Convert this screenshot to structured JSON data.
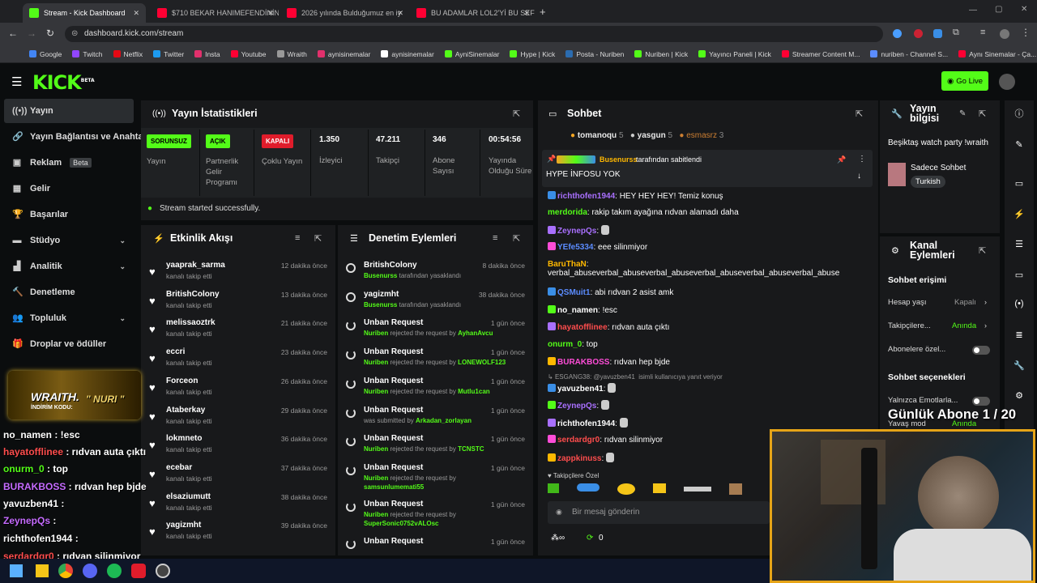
{
  "browser": {
    "tabs": [
      {
        "title": "Stream - Kick Dashboard"
      },
      {
        "title": "$710 BEKAR HANIMEFENDİNİN"
      },
      {
        "title": "2026 yılında Bulduğumuz en iy"
      },
      {
        "title": "BU ADAMLAR LOL2'Yİ BU SEFER"
      }
    ],
    "url": "dashboard.kick.com/stream",
    "bookmarks": [
      "Google",
      "Twitch",
      "Netflix",
      "Twitter",
      "Insta",
      "Youtube",
      "Wraith",
      "aynisinemalar",
      "aynisinemalar",
      "AyniSinemalar",
      "Hype | Kick",
      "Posta - Nuriben",
      "Nuriben | Kick",
      "Yayıncı Paneli | Kick",
      "Streamer Content M...",
      "nuriben - Channel S...",
      "Aynı Sinemalar - Ça..."
    ]
  },
  "header": {
    "logo": "KICK",
    "logo_beta": "BETA",
    "go_live": "Go Live"
  },
  "sidebar": {
    "items": [
      {
        "label": "Yayın"
      },
      {
        "label": "Yayın Bağlantısı ve Anahtar"
      },
      {
        "label": "Reklam",
        "badge": "Beta"
      },
      {
        "label": "Gelir"
      },
      {
        "label": "Başarılar"
      },
      {
        "label": "Stüdyo"
      },
      {
        "label": "Analitik"
      },
      {
        "label": "Denetleme"
      },
      {
        "label": "Topluluk"
      },
      {
        "label": "Droplar ve ödüller"
      }
    ]
  },
  "stats": {
    "title": "Yayın İstatistikleri",
    "items": [
      {
        "badge": "SORUNSUZ",
        "label": "Yayın"
      },
      {
        "badge": "AÇIK",
        "label": "Partnerlik Gelir Programı"
      },
      {
        "badge": "KAPALI",
        "label": "Çoklu Yayın"
      },
      {
        "value": "1.350",
        "label": "İzleyici"
      },
      {
        "value": "47.211",
        "label": "Takipçi"
      },
      {
        "value": "346",
        "label": "Abone Sayısı"
      },
      {
        "value": "00:54:56",
        "label": "Yayında Olduğu Süre"
      }
    ],
    "success": "Stream started successfully."
  },
  "activity": {
    "title": "Etkinlik Akışı",
    "items": [
      {
        "name": "yaaprak_sarma",
        "sub": "kanalı takip etti",
        "time": "12 dakika önce"
      },
      {
        "name": "BritishColony",
        "sub": "kanalı takip etti",
        "time": "13 dakika önce"
      },
      {
        "name": "melissaoztrk",
        "sub": "kanalı takip etti",
        "time": "21 dakika önce"
      },
      {
        "name": "eccri",
        "sub": "kanalı takip etti",
        "time": "23 dakika önce"
      },
      {
        "name": "Forceon",
        "sub": "kanalı takip etti",
        "time": "26 dakika önce"
      },
      {
        "name": "Ataberkay",
        "sub": "kanalı takip etti",
        "time": "29 dakika önce"
      },
      {
        "name": "lokmneto",
        "sub": "kanalı takip etti",
        "time": "36 dakika önce"
      },
      {
        "name": "ecebar",
        "sub": "kanalı takip etti",
        "time": "37 dakika önce"
      },
      {
        "name": "elsaziumutt",
        "sub": "kanalı takip etti",
        "time": "38 dakika önce"
      },
      {
        "name": "yagizmht",
        "sub": "kanalı takip etti",
        "time": "39 dakika önce"
      }
    ]
  },
  "moderation": {
    "title": "Denetim Eylemleri",
    "items": [
      {
        "name": "BritishColony",
        "actor": "Busenurss",
        "rest": "tarafından yasaklandı",
        "target": "",
        "time": "8 dakika önce"
      },
      {
        "name": "yagizmht",
        "actor": "Busenurss",
        "rest": "tarafından yasaklandı",
        "target": "",
        "time": "38 dakika önce"
      },
      {
        "name": "Unban Request",
        "actor": "Nuriben",
        "rest": "rejected the request by",
        "target": "AyhanAvcu",
        "time": "1 gün önce"
      },
      {
        "name": "Unban Request",
        "actor": "Nuriben",
        "rest": "rejected the request by",
        "target": "LONEWOLF123",
        "time": "1 gün önce"
      },
      {
        "name": "Unban Request",
        "actor": "Nuriben",
        "rest": "rejected the request by",
        "target": "Mutlu1can",
        "time": "1 gün önce"
      },
      {
        "name": "Unban Request",
        "actor": "",
        "rest": "was submitted by",
        "target": "Arkadan_zorlayan",
        "time": "1 gün önce"
      },
      {
        "name": "Unban Request",
        "actor": "Nuriben",
        "rest": "rejected the request by",
        "target": "TCNSTC",
        "time": "1 gün önce"
      },
      {
        "name": "Unban Request",
        "actor": "Nuriben",
        "rest": "rejected the request by",
        "target": "samsunlumemati55",
        "time": "1 gün önce"
      },
      {
        "name": "Unban Request",
        "actor": "Nuriben",
        "rest": "rejected the request by",
        "target": "SuperSonic0752vALOsc",
        "time": "1 gün önce"
      },
      {
        "name": "Unban Request",
        "actor": "",
        "rest": "",
        "target": "",
        "time": "1 gün önce"
      }
    ]
  },
  "chat": {
    "title": "Sohbet",
    "top_chatters": [
      {
        "name": "tomanoqu",
        "count": "5"
      },
      {
        "name": "yasgun",
        "count": "5"
      },
      {
        "name": "esmasrz",
        "count": "3"
      }
    ],
    "pinned": {
      "by": "Busenurss",
      "by_text": "tarafından sabitlendi",
      "message": "HYPE İNFOSU YOK"
    },
    "messages": [
      {
        "user": "richthofen1944",
        "color": "#a970ff",
        "text": "HEY HEY HEY! Temiz konuş"
      },
      {
        "user": "merdorida",
        "color": "#53fc18",
        "text": "rakip takım ayağına rıdvan alamadı daha"
      },
      {
        "user": "ZeynepQs",
        "color": "#a970ff",
        "text": ""
      },
      {
        "user": "YEfe5334",
        "color": "#5b8cff",
        "text": "eee silinmiyor"
      },
      {
        "user": "BaruThaN",
        "color": "#ffb800",
        "text": "verbal_abuseverbal_abuseverbal_abuseverbal_abuseverbal_abuseverbal_abuse"
      },
      {
        "user": "QSMuit1",
        "color": "#5b8cff",
        "text": "abi rıdvan 2 asist amk"
      },
      {
        "user": "no_namen",
        "color": "#ffffff",
        "text": "!esc"
      },
      {
        "user": "hayatofflinee",
        "color": "#ff4d4d",
        "text": "rıdvan auta çıktı"
      },
      {
        "user": "onurm_0",
        "color": "#53fc18",
        "text": "top"
      },
      {
        "user": "BURAKBOSS",
        "color": "#ff4dd8",
        "text": "rıdvan hep bjde"
      },
      {
        "user": "yavuzben41",
        "color": "#ffffff",
        "text": ""
      },
      {
        "user": "ZeynepQs",
        "color": "#a970ff",
        "text": ""
      },
      {
        "user": "richthofen1944",
        "color": "#ffffff",
        "text": ""
      },
      {
        "user": "serdardgr0",
        "color": "#ff4d4d",
        "text": "rıdvan silinmiyor"
      },
      {
        "user": "zappkinuss",
        "color": "#ff4d4d",
        "text": ""
      }
    ],
    "reply_context": "ESGANG38: @yavuzben41",
    "reply_hint": "isimli kullanıcıya yanıt veriyor",
    "followers_only": "Takipçilere Özel",
    "input_placeholder": "Bir mesaj gönderin",
    "points": "0"
  },
  "stream_info": {
    "title": "Yayın bilgisi",
    "stream_title": "Beşiktaş watch party !wraith",
    "category": "Sadece Sohbet",
    "language": "Turkish"
  },
  "channel_actions": {
    "title": "Kanal Eylemleri",
    "chat_access": "Sohbet erişimi",
    "rows": [
      {
        "label": "Hesap yaşı",
        "value": "Kapalı"
      },
      {
        "label": "Takipçilere...",
        "value": "Anında"
      },
      {
        "label": "Abonelere özel...",
        "value": ""
      }
    ],
    "chat_options": "Sohbet seçenekleri",
    "emote_only": "Yalnızca Emotlarla...",
    "slow_mode": "Yavaş mod",
    "slow_value": "Anında"
  },
  "overlay": {
    "sub_goal": "Günlük Abone 1 / 20",
    "wraith_brand": "WRAITH.",
    "wraith_code_label": "İNDİRİM KODU:",
    "wraith_code": "\" NURI \"",
    "chat": [
      {
        "user": "no_namen",
        "text": " : !esc",
        "color": "#ffffff"
      },
      {
        "user": "hayatofflinee",
        "text": " : rıdvan auta çıktı",
        "color": "#ff4d4d"
      },
      {
        "user": "onurm_0",
        "text": " : top",
        "color": "#53fc18"
      },
      {
        "user": "BURAKBOSS",
        "text": " : rıdvan hep bjde",
        "color": "#c56bff"
      },
      {
        "user": "yavuzben41",
        "text": " : ",
        "color": "#ffffff"
      },
      {
        "user": "ZeynepQs",
        "text": " : ",
        "color": "#c56bff"
      },
      {
        "user": "richthofen1944",
        "text": " : ",
        "color": "#ffffff"
      },
      {
        "user": "serdardgr0",
        "text": " : rıdvan silinmiyor",
        "color": "#ff4d4d"
      }
    ]
  }
}
